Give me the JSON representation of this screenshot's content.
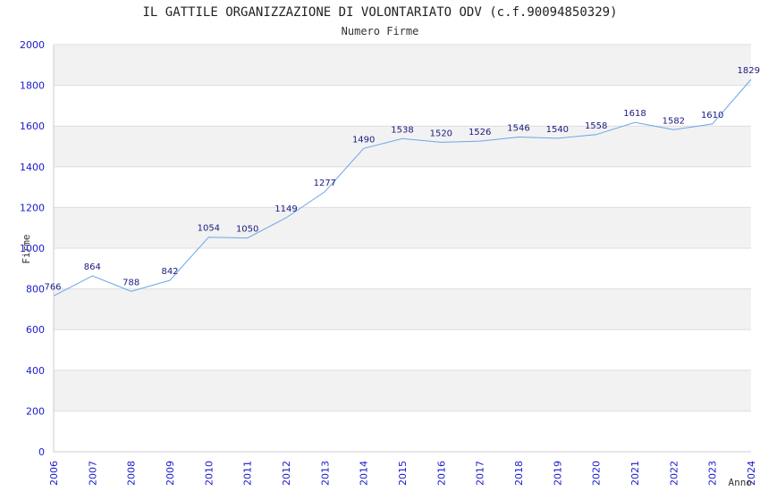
{
  "chart_data": {
    "type": "line",
    "title": "IL GATTILE ORGANIZZAZIONE DI VOLONTARIATO ODV (c.f.90094850329)",
    "subtitle": "Numero Firme",
    "xlabel": "Anno",
    "ylabel": "Firme",
    "x": [
      "2006",
      "2007",
      "2008",
      "2009",
      "2010",
      "2011",
      "2012",
      "2013",
      "2014",
      "2015",
      "2016",
      "2017",
      "2018",
      "2019",
      "2020",
      "2021",
      "2022",
      "2023",
      "2024"
    ],
    "series": [
      {
        "values": [
          766,
          864,
          788,
          842,
          1054,
          1050,
          1149,
          1277,
          1490,
          1538,
          1520,
          1526,
          1546,
          1540,
          1558,
          1618,
          1582,
          1610,
          1829
        ]
      }
    ],
    "ylim": [
      0,
      2000
    ],
    "yticks": [
      0,
      200,
      400,
      600,
      800,
      1000,
      1200,
      1400,
      1600,
      1800,
      2000
    ],
    "grid": true,
    "legend": "none",
    "colors": {
      "line": "#6aa6e8",
      "band": "#f2f2f2",
      "grid": "#dddddd",
      "tick_text": "#1a1acc",
      "data_label": "#1a1a80"
    }
  }
}
